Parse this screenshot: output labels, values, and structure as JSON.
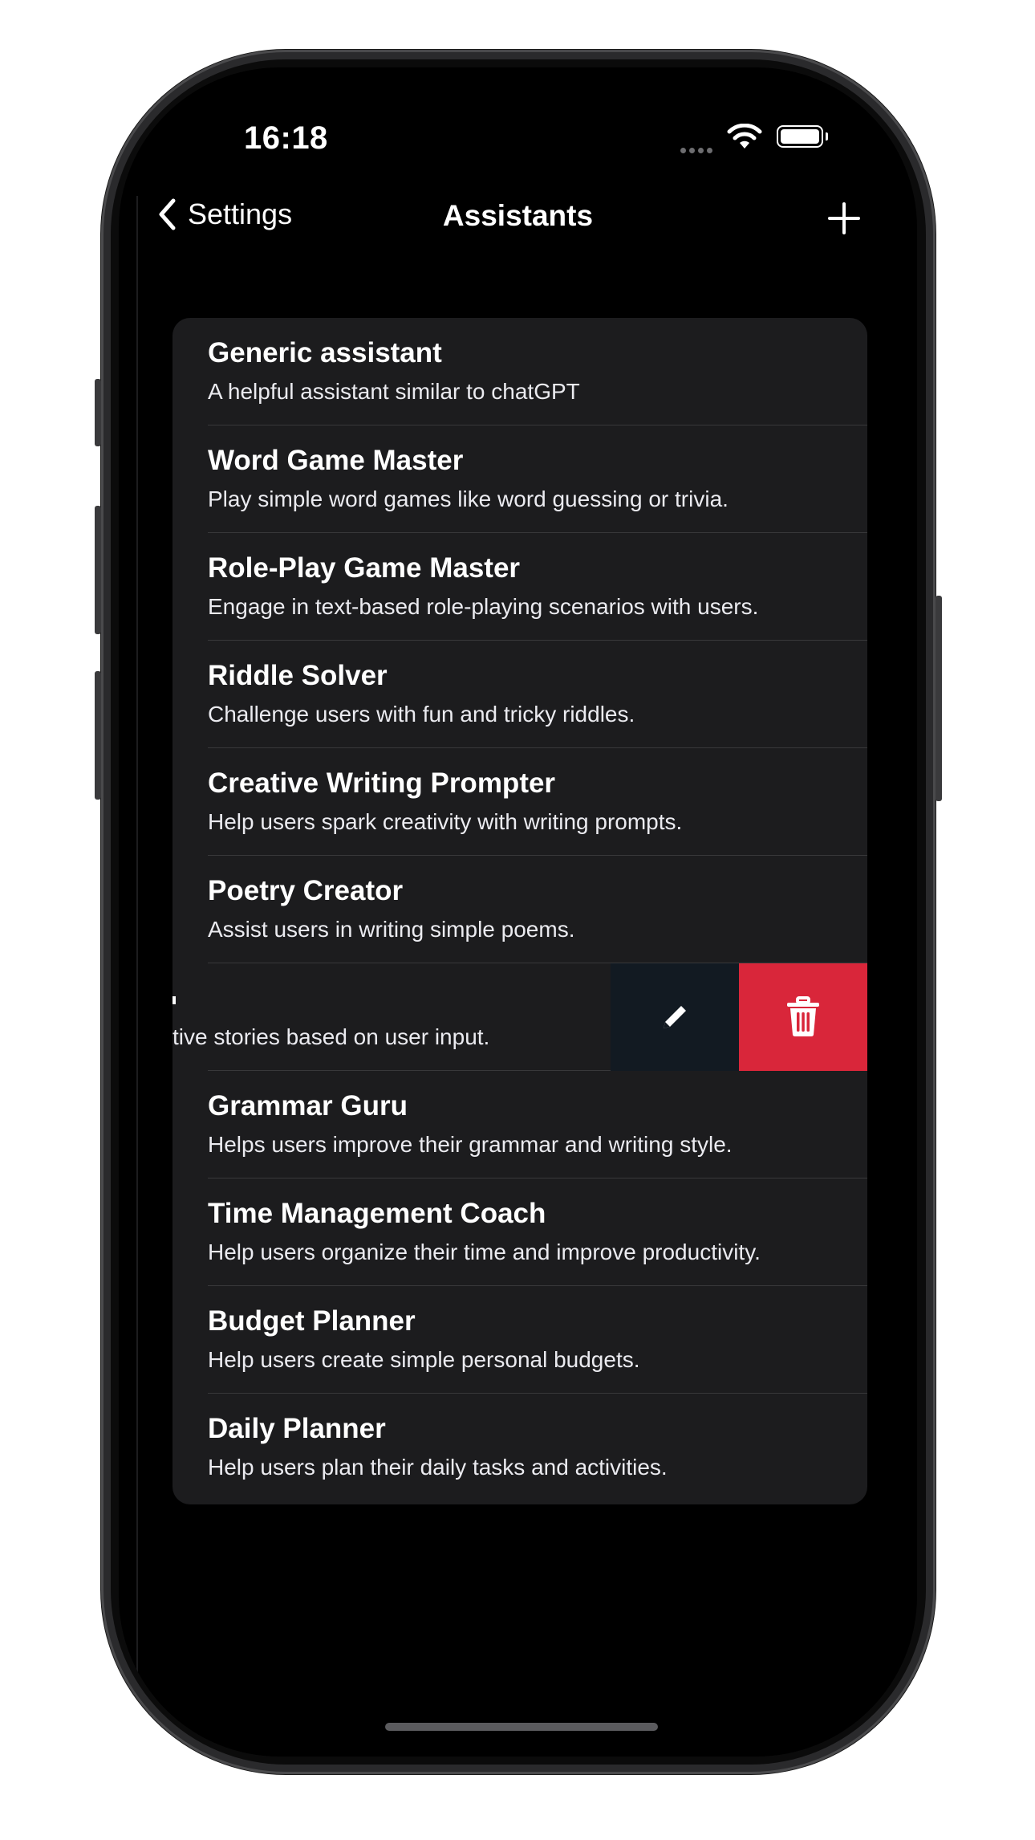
{
  "status_bar": {
    "time": "16:18"
  },
  "nav": {
    "back_label": "Settings",
    "title": "Assistants"
  },
  "assistants": [
    {
      "title": "Generic assistant",
      "description": "A helpful assistant similar to chatGPT"
    },
    {
      "title": "Word Game Master",
      "description": "Play simple word games like word guessing or trivia."
    },
    {
      "title": "Role-Play Game Master",
      "description": "Engage in text-based role-playing scenarios with users."
    },
    {
      "title": "Riddle Solver",
      "description": "Challenge users with fun and tricky riddles."
    },
    {
      "title": "Creative Writing Prompter",
      "description": "Help users spark creativity with writing prompts."
    },
    {
      "title": "Poetry Creator",
      "description": "Assist users in writing simple poems."
    },
    {
      "title": "",
      "description": "tive stories based on user input.",
      "swiped": true
    },
    {
      "title": "Grammar Guru",
      "description": "Helps users improve their grammar and writing style."
    },
    {
      "title": "Time Management Coach",
      "description": "Help users organize their time and improve productivity."
    },
    {
      "title": "Budget Planner",
      "description": "Help users create simple personal budgets."
    },
    {
      "title": "Daily Planner",
      "description": "Help users plan their daily tasks and activities."
    }
  ],
  "swipe_actions": {
    "edit_color": "#121a22",
    "delete_color": "#d9263a",
    "edit_icon": "pencil-icon",
    "delete_icon": "trash-icon"
  }
}
